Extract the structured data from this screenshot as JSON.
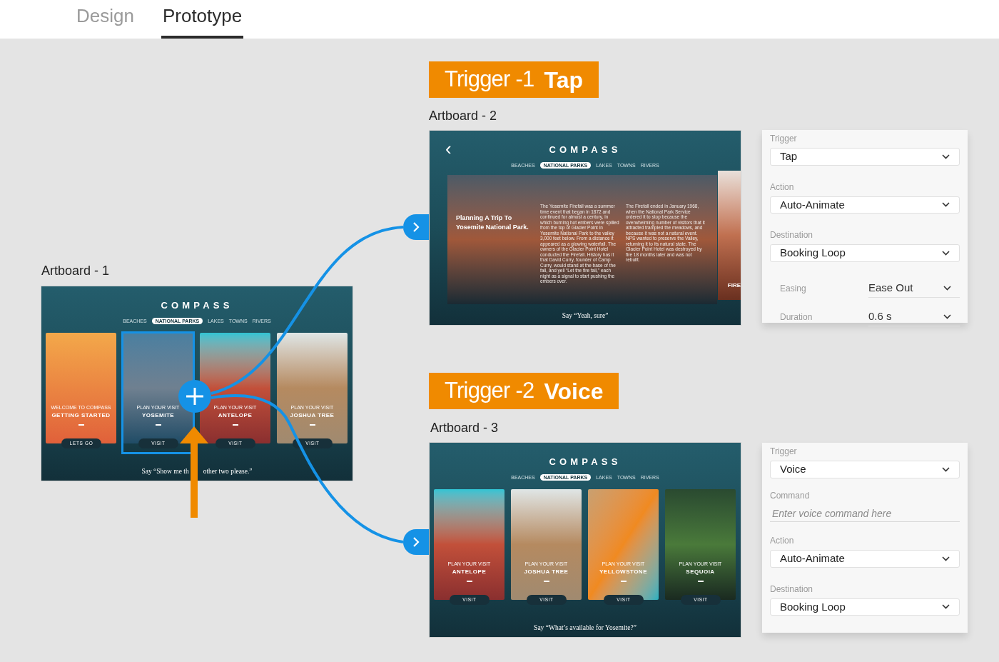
{
  "tabs": [
    {
      "label": "Design",
      "selected": false
    },
    {
      "label": "Prototype",
      "selected": true
    }
  ],
  "triggers": [
    {
      "name": "Trigger -1",
      "type": "Tap"
    },
    {
      "name": "Trigger -2",
      "type": "Voice"
    }
  ],
  "artboards": [
    {
      "label": "Artboard - 1",
      "kind": "cards",
      "title": "COMPASS",
      "nav": [
        {
          "label": "BEACHES",
          "selected": false
        },
        {
          "label": "NATIONAL PARKS",
          "selected": true
        },
        {
          "label": "LAKES",
          "selected": false
        },
        {
          "label": "TOWNS",
          "selected": false
        },
        {
          "label": "RIVERS",
          "selected": false
        }
      ],
      "cards": [
        {
          "eyebrow": "WELCOME TO COMPASS",
          "title": "GETTING STARTED",
          "button": "LETS GO",
          "selected": false
        },
        {
          "eyebrow": "PLAN YOUR VISIT",
          "title": "YOSEMITE",
          "button": "VISIT",
          "selected": true
        },
        {
          "eyebrow": "PLAN YOUR VISIT",
          "title": "ANTELOPE",
          "button": "VISIT",
          "selected": false
        },
        {
          "eyebrow": "PLAN YOUR VISIT",
          "title": "JOSHUA TREE",
          "button": "VISIT",
          "selected": false
        }
      ],
      "prompt": [
        "Say “Show me th",
        "other two please.”"
      ]
    },
    {
      "label": "Artboard - 2",
      "kind": "article",
      "back": "‹",
      "title": "COMPASS",
      "nav": [
        {
          "label": "BEACHES",
          "selected": false
        },
        {
          "label": "NATIONAL PARKS",
          "selected": true
        },
        {
          "label": "LAKES",
          "selected": false
        },
        {
          "label": "TOWNS",
          "selected": false
        },
        {
          "label": "RIVERS",
          "selected": false
        }
      ],
      "heading": "Planning A Trip To Yosemite National Park.",
      "paragraphs": [
        "The Yosemite Firefall was a summer time event that began in 1872 and continued for almost a century, in which burning hot embers were spilled from the top of Glacier Point in Yosemite National Park to the valley 3,000 feet below. From a distance it appeared as a glowing waterfall. The owners of the Glacier Point Hotel conducted the Firefall. History has it that David Curry, founder of Camp Curry, would stand at the base of the fall, and yell “Let the fire fall,” each night as a signal to start pushing the embers over.",
        "The Firefall ended in January 1968, when the National Park Service ordered it to stop because the overwhelming number of visitors that it attracted trampled the meadows, and because it was not a natural event. NPS wanted to preserve the Valley, returning it to its natural state. The Glacier Point Hotel was destroyed by fire 18 months later and was not rebuilt."
      ],
      "side_card": "FIRE",
      "prompt": [
        "Say “Yeah, sure”"
      ]
    },
    {
      "label": "Artboard - 3",
      "kind": "cards",
      "title": "COMPASS",
      "nav": [
        {
          "label": "BEACHES",
          "selected": false
        },
        {
          "label": "NATIONAL PARKS",
          "selected": true
        },
        {
          "label": "LAKES",
          "selected": false
        },
        {
          "label": "TOWNS",
          "selected": false
        },
        {
          "label": "RIVERS",
          "selected": false
        }
      ],
      "cards": [
        {
          "eyebrow": "PLAN YOUR VISIT",
          "title": "ANTELOPE",
          "button": "VISIT",
          "selected": false
        },
        {
          "eyebrow": "PLAN YOUR VISIT",
          "title": "JOSHUA TREE",
          "button": "VISIT",
          "selected": false
        },
        {
          "eyebrow": "PLAN YOUR VISIT",
          "title": "YELLOWSTONE",
          "button": "VISIT",
          "selected": false
        },
        {
          "eyebrow": "PLAN YOUR VISIT",
          "title": "SEQUOIA",
          "button": "VISIT",
          "selected": false
        }
      ],
      "prompt": [
        "Say “What’s available for Yosemite?”"
      ]
    }
  ],
  "panels": [
    {
      "fields": [
        {
          "kind": "dropdown",
          "label": "Trigger",
          "value": "Tap"
        },
        {
          "kind": "dropdown",
          "label": "Action",
          "value": "Auto-Animate"
        },
        {
          "kind": "dropdown",
          "label": "Destination",
          "value": "Booking Loop"
        },
        {
          "kind": "inline",
          "label": "Easing",
          "value": "Ease Out"
        },
        {
          "kind": "inline",
          "label": "Duration",
          "value": "0.6 s"
        }
      ]
    },
    {
      "fields": [
        {
          "kind": "dropdown",
          "label": "Trigger",
          "value": "Voice"
        },
        {
          "kind": "text",
          "label": "Command",
          "placeholder": "Enter voice command here"
        },
        {
          "kind": "dropdown",
          "label": "Action",
          "value": "Auto-Animate"
        },
        {
          "kind": "dropdown",
          "label": "Destination",
          "value": "Booking Loop"
        }
      ]
    }
  ]
}
